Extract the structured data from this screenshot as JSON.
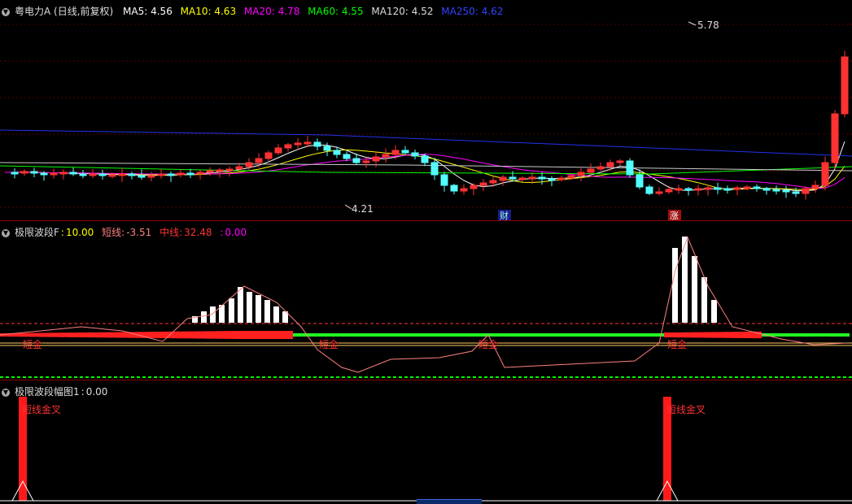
{
  "main": {
    "title": "粤电力A (日线,前复权)",
    "ma": [
      {
        "label": "MA5:",
        "value": "4.56",
        "color": "#ffffff"
      },
      {
        "label": "MA10:",
        "value": "4.63",
        "color": "#ffff00"
      },
      {
        "label": "MA20:",
        "value": "4.78",
        "color": "#ff00ff"
      },
      {
        "label": "MA60:",
        "value": "4.55",
        "color": "#00ff00"
      },
      {
        "label": "MA120:",
        "value": "4.52",
        "color": "#dddddd"
      },
      {
        "label": "MA250:",
        "value": "4.62",
        "color": "#3344ff"
      }
    ],
    "high_label": "5.78",
    "low_label": "4.21",
    "tag_cai": "财",
    "tag_zhang": "涨"
  },
  "indicator1": {
    "name": "极限波段F",
    "value": "10.00",
    "short_label": "短线:",
    "short_value": "-3.51",
    "mid_label": "中线:",
    "mid_value": "32.48",
    "extra_value": "0.00",
    "signal_text": "短金"
  },
  "indicator2": {
    "name": "极限波段幅图1",
    "value": "0.00",
    "signal_text": "短线金叉"
  },
  "colors": {
    "up": "#ff3232",
    "down": "#54ffff",
    "bg": "#000000",
    "grid": "#8b0000"
  }
}
